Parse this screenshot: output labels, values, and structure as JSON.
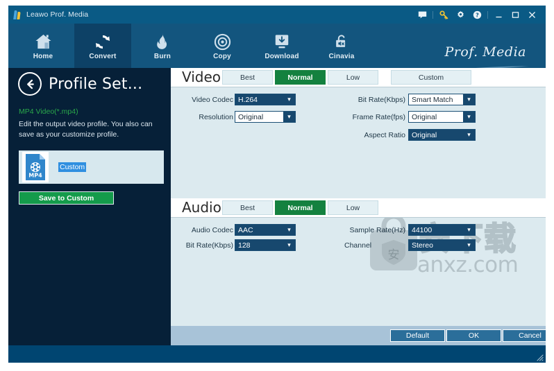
{
  "window": {
    "app_title": "Leawo Prof. Media",
    "brand_script": "Prof. Media",
    "logo_icon": "leawo-logo-icon"
  },
  "titlebar_icons": [
    {
      "name": "message-icon",
      "glyph": "speech-bubble"
    },
    {
      "name": "key-icon",
      "glyph": "key",
      "color": "#f2c432"
    },
    {
      "name": "settings-icon",
      "glyph": "gear"
    },
    {
      "name": "help-icon",
      "glyph": "question-circle"
    },
    {
      "name": "minimize-icon",
      "glyph": "minimize"
    },
    {
      "name": "maximize-icon",
      "glyph": "maximize"
    },
    {
      "name": "close-icon",
      "glyph": "close"
    }
  ],
  "nav": {
    "items": [
      {
        "label": "Home",
        "icon": "home-icon",
        "active": false
      },
      {
        "label": "Convert",
        "icon": "convert-icon",
        "active": true
      },
      {
        "label": "Burn",
        "icon": "flame-icon",
        "active": false
      },
      {
        "label": "Copy",
        "icon": "disc-icon",
        "active": false
      },
      {
        "label": "Download",
        "icon": "download-icon",
        "active": false
      },
      {
        "label": "Cinavia",
        "icon": "cinavia-unlock-icon",
        "active": false
      }
    ]
  },
  "sidebar": {
    "back_icon": "back-arrow-icon",
    "title": "Profile Set...",
    "profile_type": "MP4 Video(*.mp4)",
    "description": "Edit the output video profile. You also can save as your customize profile.",
    "card": {
      "format_icon": "mp4-film-icon",
      "format_label": "MP4",
      "name_value": "Custom",
      "name_selected": true
    },
    "save_button": "Save to Custom"
  },
  "video": {
    "section_title": "Video",
    "tabs": [
      {
        "label": "Best",
        "active": false
      },
      {
        "label": "Normal",
        "active": true
      },
      {
        "label": "Low",
        "active": false
      },
      {
        "label": "Custom",
        "active": false
      }
    ],
    "fields_left": [
      {
        "label": "Video Codec",
        "value": "H.264",
        "style": "filled"
      },
      {
        "label": "Resolution",
        "value": "Original",
        "style": "plain"
      }
    ],
    "fields_right": [
      {
        "label": "Bit Rate(Kbps)",
        "value": "Smart Match",
        "style": "plain"
      },
      {
        "label": "Frame Rate(fps)",
        "value": "Original",
        "style": "plain"
      },
      {
        "label": "Aspect Ratio",
        "value": "Original",
        "style": "filled"
      }
    ]
  },
  "audio": {
    "section_title": "Audio",
    "tabs": [
      {
        "label": "Best",
        "active": false
      },
      {
        "label": "Normal",
        "active": true
      },
      {
        "label": "Low",
        "active": false
      }
    ],
    "fields_left": [
      {
        "label": "Audio Codec",
        "value": "AAC",
        "style": "filled"
      },
      {
        "label": "Bit Rate(Kbps)",
        "value": "128",
        "style": "filled"
      }
    ],
    "fields_right": [
      {
        "label": "Sample Rate(Hz)",
        "value": "44100",
        "style": "filled"
      },
      {
        "label": "Channel",
        "value": "Stereo",
        "style": "filled"
      }
    ]
  },
  "footer": {
    "buttons": [
      {
        "label": "Default"
      },
      {
        "label": "OK"
      },
      {
        "label": "Cancel"
      }
    ]
  },
  "watermark": {
    "cn_text": "安下载",
    "en_text": "anxz.com",
    "bag_icon": "watermark-bag-icon"
  },
  "colors": {
    "titlebar": "#0a5a85",
    "navbar": "#13557e",
    "nav_active": "#0d4166",
    "sidebar": "#062038",
    "content": "#dceaef",
    "accent_green": "#14813f",
    "save_green": "#149b4b",
    "profile_type_green": "#2aa84a",
    "dropdown_fill": "#17486e",
    "footer_bar": "#a8c3d8",
    "footer_button": "#2b6e9a",
    "selection_blue": "#2f8fe0",
    "window_bg": "#004571"
  }
}
